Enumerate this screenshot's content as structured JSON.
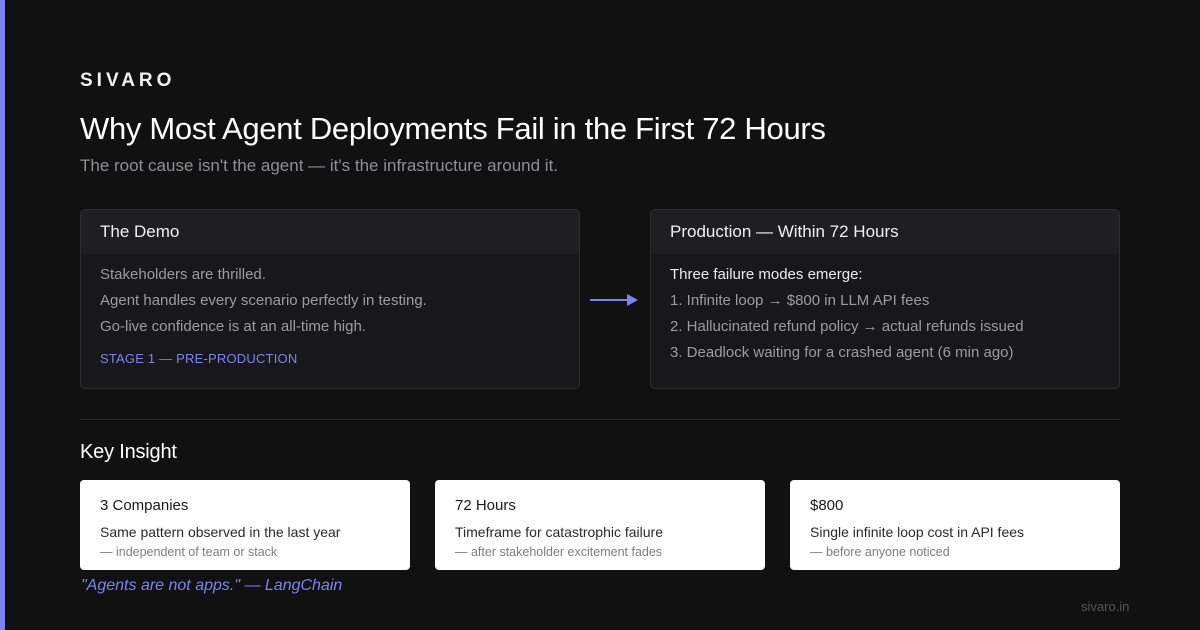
{
  "brand": "SIVARO",
  "title": "Why Most Agent Deployments Fail in the First 72 Hours",
  "subtitle": "The root cause isn't the agent — it's the infrastructure around it.",
  "colors": {
    "accent": "#7b84ee",
    "background": "#111112",
    "card": "#18181b"
  },
  "demo_card": {
    "heading": "The Demo",
    "lines": [
      "Stakeholders are thrilled.",
      "Agent handles every scenario perfectly in testing.",
      "Go-live confidence is at an all-time high."
    ],
    "stage": "STAGE 1 — PRE-PRODUCTION"
  },
  "arrow_icon": "arrow-right-icon",
  "production_card": {
    "heading": "Production — Within 72 Hours",
    "lead": "Three failure modes emerge:",
    "lines": [
      "1. Infinite loop → $800 in LLM API fees",
      "2. Hallucinated refund policy → actual refunds issued",
      "3. Deadlock waiting for a crashed agent (6 min ago)"
    ]
  },
  "insight": {
    "title": "Key Insight",
    "stats": [
      {
        "value": "3 Companies",
        "description": "Same pattern observed in the last year",
        "note": "— independent of team or stack"
      },
      {
        "value": "72 Hours",
        "description": "Timeframe for catastrophic failure",
        "note": "— after stakeholder excitement fades"
      },
      {
        "value": "$800",
        "description": "Single infinite loop cost in API fees",
        "note": "— before anyone noticed"
      }
    ]
  },
  "quote": "\"Agents are not apps.\" — LangChain",
  "footer_url": "sivaro.in"
}
